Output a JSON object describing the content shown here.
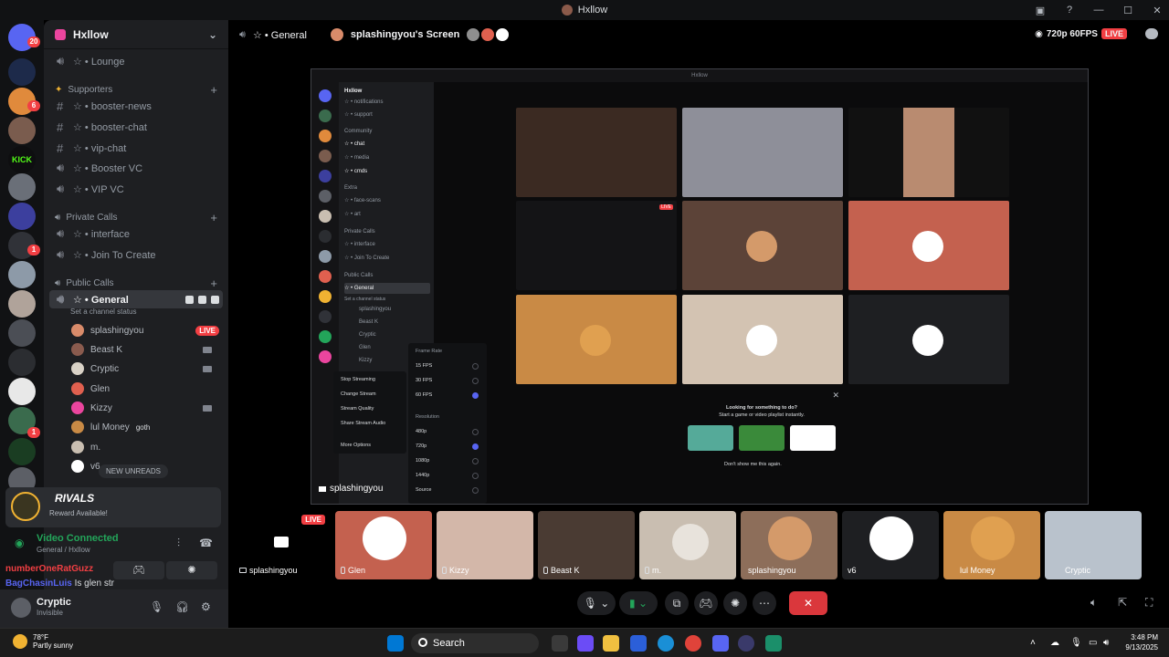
{
  "window": {
    "title": "Hxllow"
  },
  "rail": {
    "dm_badge": "20",
    "badges": [
      "6",
      "1",
      "1",
      "1"
    ],
    "kick_label": "KICK"
  },
  "sidebar": {
    "guild_name": "Hxllow",
    "channels": [
      {
        "name": "☆ • Lounge",
        "type": "voice"
      },
      {
        "name": "Supporters",
        "type": "category"
      },
      {
        "name": "☆ • booster-news",
        "type": "text"
      },
      {
        "name": "☆ • booster-chat",
        "type": "text"
      },
      {
        "name": "☆ • vip-chat",
        "type": "text"
      },
      {
        "name": "☆ • Booster VC",
        "type": "voice"
      },
      {
        "name": "☆ • VIP VC",
        "type": "voice"
      },
      {
        "name": "Private Calls",
        "type": "category"
      },
      {
        "name": "☆ • interface",
        "type": "voice"
      },
      {
        "name": "☆ • Join To Create",
        "type": "voice"
      },
      {
        "name": "Public Calls",
        "type": "category"
      },
      {
        "name": "☆ • General",
        "type": "voice"
      }
    ],
    "channel_status": "Set a channel status",
    "voice_users": [
      {
        "name": "splashingyou",
        "live": "LIVE",
        "color": "#d98b6a"
      },
      {
        "name": "Beast K",
        "color": "#8a5b4e"
      },
      {
        "name": "Cryptic",
        "color": "#d9d2c7"
      },
      {
        "name": "Glen",
        "color": "#e0604f"
      },
      {
        "name": "Kizzy",
        "color": "#eb459e"
      },
      {
        "name": "lul Money",
        "badge": "goth",
        "color": "#c98a45"
      },
      {
        "name": "m.",
        "color": "#c9beb1"
      },
      {
        "name": "v6",
        "color": "#ffffff"
      }
    ],
    "new_unreads": "NEW UNREADS"
  },
  "reward": {
    "title": "RIVALS",
    "subtitle": "Reward Available!"
  },
  "voice": {
    "status": "Video Connected",
    "location": "General / Hxllow"
  },
  "chat_preview": [
    {
      "name": "numberOneRatGuzz",
      "text": ""
    },
    {
      "name": "BagChasinLuis",
      "text": "Is glen str"
    }
  ],
  "user": {
    "name": "Cryptic",
    "status": "Invisible"
  },
  "call": {
    "channel": "☆ • General",
    "stream_title": "splashingyou's Screen",
    "quality": "720p 60FPS",
    "live_badge": "LIVE"
  },
  "stream": {
    "window_title": "Hxllow",
    "guild": "Hxllow",
    "channels": [
      "☆ • notifications",
      "☆ • support",
      "Community",
      "☆ • chat",
      "☆ • media",
      "☆ • cmds",
      "Extra",
      "☆ • face-scans",
      "☆ • art",
      "Private Calls",
      "☆ • interface",
      "☆ • Join To Create",
      "Public Calls",
      "☆ • General",
      "Set a channel status",
      "splashingyou",
      "Beast K",
      "Cryptic",
      "Glen",
      "Kizzy"
    ],
    "menu": [
      "Stop Streaming",
      "Change Stream",
      "Stream Quality",
      "Share Stream Audio",
      "More Options"
    ],
    "frame_rate_label": "Frame Rate",
    "frame_rates": [
      "15 FPS",
      "30 FPS",
      "60 FPS"
    ],
    "resolution_label": "Resolution",
    "resolutions": [
      "480p",
      "720p",
      "1080p",
      "1440p",
      "Source"
    ],
    "promo_title": "Looking for something to do?",
    "promo_sub": "Start a game or video playlist instantly.",
    "promo_check": "Don't show me this again.",
    "user": "splashingyou",
    "live": "LIVE"
  },
  "participants": [
    {
      "name": "splashingyou",
      "live": "LIVE",
      "color": "#2b2d31"
    },
    {
      "name": "Glen",
      "color": "#c4614f"
    },
    {
      "name": "Kizzy",
      "color": "#d3b7a9"
    },
    {
      "name": "Beast K",
      "color": "#4a3b33"
    },
    {
      "name": "m.",
      "color": "#c9beb1"
    },
    {
      "name": "splashingyou",
      "color": "#8d6e5a"
    },
    {
      "name": "v6",
      "color": "#2b2d31"
    },
    {
      "name": "lul Money",
      "color": "#c98a45"
    },
    {
      "name": "Cryptic",
      "color": "#b9c2cc"
    }
  ],
  "taskbar": {
    "temp": "78°F",
    "weather": "Partly sunny",
    "search": "Search",
    "time": "3:48 PM",
    "date": "9/13/2025"
  }
}
